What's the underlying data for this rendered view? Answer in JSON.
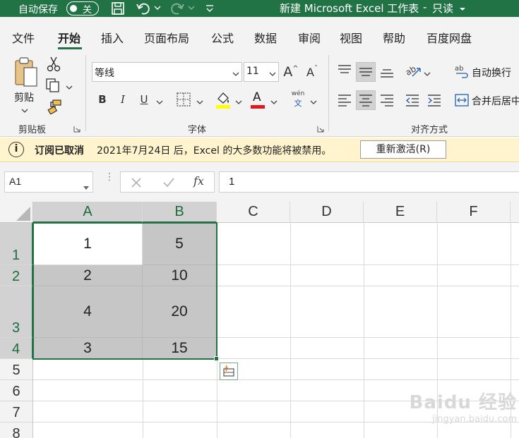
{
  "titlebar": {
    "autosave_label": "自动保存",
    "autosave_state": "关",
    "document_title": "新建 Microsoft Excel 工作表",
    "separator": "-",
    "mode": "只读"
  },
  "menu": {
    "items": [
      "文件",
      "开始",
      "插入",
      "页面布局",
      "公式",
      "数据",
      "审阅",
      "视图",
      "帮助",
      "百度网盘"
    ],
    "active": "开始"
  },
  "ribbon": {
    "clipboard": {
      "paste_label": "剪贴",
      "group_label": "剪贴板"
    },
    "font": {
      "font_name": "等线",
      "font_size": "11",
      "bold": "B",
      "italic": "I",
      "underline": "U",
      "font_color_glyph": "A",
      "phonetic_top": "wén",
      "phonetic_bottom": "文",
      "grow_glyph": "A",
      "shrink_glyph": "A",
      "group_label": "字体",
      "highlight_color": "#ffff00",
      "font_color": "#e01a1a"
    },
    "alignment": {
      "wrap_text_label": "自动换行",
      "merge_center_label": "合并后居中",
      "group_label": "对齐方式"
    }
  },
  "infobar": {
    "title": "订阅已取消",
    "message": "2021年7月24日 后，Excel 的大多数功能将被禁用。",
    "button_label": "重新激活(R)"
  },
  "formula_bar": {
    "name_box": "A1",
    "fx": "fx",
    "value": "1"
  },
  "sheet": {
    "columns": [
      "A",
      "B",
      "C",
      "D",
      "E",
      "F"
    ],
    "rows": [
      "1",
      "2",
      "3",
      "4",
      "5",
      "6",
      "7",
      "8"
    ],
    "cells": {
      "A1": "1",
      "B1": "5",
      "A2": "2",
      "B2": "10",
      "A3": "4",
      "B3": "20",
      "A4": "3",
      "B4": "15"
    },
    "selection": "A1:B4"
  },
  "watermark": {
    "brand": "Baidu 经验",
    "url": "jingyan.baidu.com"
  },
  "colors": {
    "excel_green": "#217346",
    "ribbon_bg": "#f3f3f3",
    "infobar_bg": "#fff4cd",
    "selection_fill": "#c6c6c6"
  }
}
